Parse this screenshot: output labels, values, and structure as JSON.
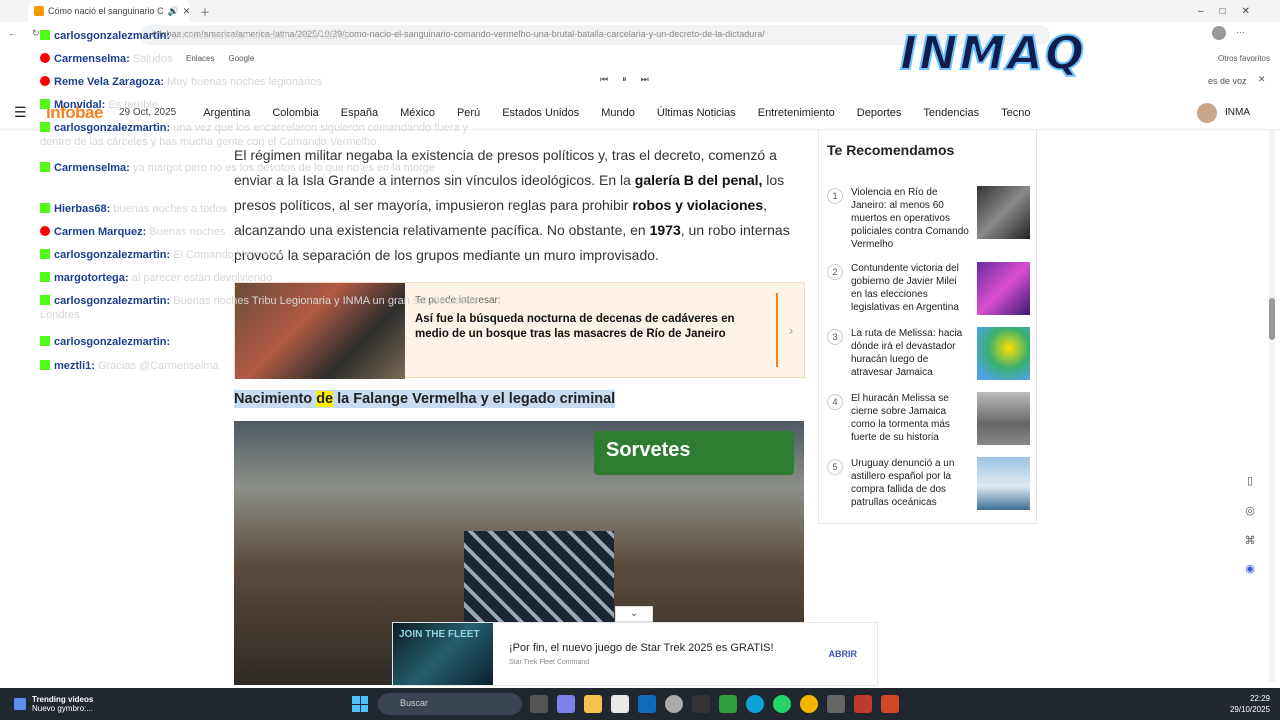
{
  "browser": {
    "tab_title": "Cómo nació el sanguinario C",
    "url": "infobae.com/america/america-latina/2025/10/29/como-nacio-el-sanguinario-comando-vermelho-una-brutal-batalla-carcelaria-y-un-decreto-de-la-dictadura/",
    "bookmarks": [
      "Enlaces",
      "Google"
    ],
    "other_favorites": "Otros favoritos",
    "voice": "es de voz"
  },
  "site": {
    "logo": "infobae",
    "date": "29 Oct, 2025",
    "nav": [
      "Argentina",
      "Colombia",
      "España",
      "México",
      "Perú",
      "Estados Unidos",
      "Mundo",
      "Últimas Noticias",
      "Entretenimiento",
      "Deportes",
      "Tendencias",
      "Tecno"
    ],
    "user": "INMA"
  },
  "article": {
    "p1_a": "El régimen militar negaba la existencia de presos políticos y, tras el decreto, comenzó a enviar a la Isla Grande a internos sin vínculos ideológicos. En la ",
    "p1_b1": "galería B del penal,",
    "p1_c": " los presos políticos, al ser mayoría, impusieron reglas para prohibir ",
    "p1_b2": "robos y violaciones",
    "p1_d": ", alcanzando una existencia relativamente pacífica. No obstante, en ",
    "p1_b3": "1973",
    "p1_e": ", un robo internas provocó la separación de los grupos mediante un muro improvisado.",
    "teaser_kicker": "Te puede interesar:",
    "teaser_title": "Así fue la búsqueda nocturna de decenas de cadáveres en medio de un bosque tras las masacres de Río de Janeiro",
    "subhead_a": "Nacimiento ",
    "subhead_hl": "de",
    "subhead_b": " la Falange Vermelha y el legado criminal",
    "photo_sign": "Sorvetes"
  },
  "sidebar": {
    "title": "Te Recomendamos",
    "items": [
      {
        "n": "1",
        "text": "Violencia en Río de Janeiro: al menos 60 muertos en operativos policiales contra Comando Vermelho"
      },
      {
        "n": "2",
        "text": "Contundente victoria del gobierno de Javier Milei en las elecciones legislativas en Argentina"
      },
      {
        "n": "3",
        "text": "La ruta de Melissa: hacia dónde irá el devastador huracán luego de atravesar Jamaica"
      },
      {
        "n": "4",
        "text": "El huracán Melissa se cierne sobre Jamaica como la tormenta más fuerte de su historia"
      },
      {
        "n": "5",
        "text": "Uruguay denunció a un astillero español por la compra fallida de dos patrullas oceánicas"
      }
    ]
  },
  "chat": [
    {
      "src": "kick",
      "user": "carlosgonzalezmartin:",
      "msg": "infobae.com/america/america-latina"
    },
    {
      "src": "yt",
      "user": "Carmenselma:",
      "msg": "Saludos"
    },
    {
      "src": "yt",
      "user": "Reme Vela Zaragoza:",
      "msg": "Muy buenas noches legionarios"
    },
    {
      "src": "kick",
      "user": "Monvidal:",
      "msg": "Es terrible"
    },
    {
      "src": "kick",
      "user": "carlosgonzalezmartin:",
      "msg": "una vez que los encarcelaron siguieron comandando fuera y dentro de las cárceles y has mucha gente con el Comando Vermelho"
    },
    {
      "src": "kick",
      "user": "Carmenselma:",
      "msg": "ya margot pero no es los devotos de lo que no es en la morge"
    },
    {
      "src": "kick",
      "user": "Hierbas68:",
      "msg": "buenas noches a todos"
    },
    {
      "src": "yt",
      "user": "Carmen Marquez:",
      "msg": "Buenas noches"
    },
    {
      "src": "kick",
      "user": "carlosgonzalezmartin:",
      "msg": "El Comando Vermelho"
    },
    {
      "src": "kick",
      "user": "margotortega:",
      "msg": "al parecer están devolviendo"
    },
    {
      "src": "kick",
      "user": "carlosgonzalezmartin:",
      "msg": "Buenas noches Tribu Legionaria y INMA un gran saludo desde Londres"
    },
    {
      "src": "kick",
      "user": "carlosgonzalezmartin:",
      "msg": ""
    },
    {
      "src": "kick",
      "user": "meztli1:",
      "msg": "Gracias @Carmenselma"
    }
  ],
  "overlay_logo": "INMAQ",
  "ad": {
    "image_text": "JOIN THE FLEET",
    "title": "¡Por fin, el nuevo juego de Star Trek 2025 es GRATIS!",
    "brand": "Star Trek Fleet Command",
    "button": "ABRIR"
  },
  "taskbar": {
    "trending_title": "Trending videos",
    "trending_sub": "Nuevo gymbro:...",
    "search_placeholder": "Buscar",
    "time": "22:29",
    "date": "29/10/2025"
  }
}
